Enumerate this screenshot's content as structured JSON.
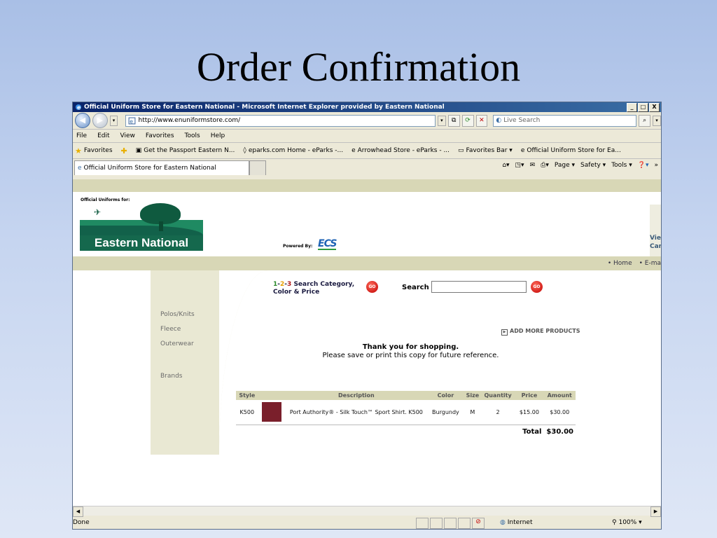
{
  "slide": {
    "title": "Order Confirmation"
  },
  "browser": {
    "title": "Official Uniform Store for Eastern National - Microsoft Internet Explorer provided by Eastern National",
    "window_buttons": [
      "_",
      "□",
      "X"
    ],
    "address": "http://www.enuniformstore.com/",
    "search_placeholder": "Live Search",
    "menu": [
      "File",
      "Edit",
      "View",
      "Favorites",
      "Tools",
      "Help"
    ],
    "favorites_label": "Favorites",
    "favorites_items": [
      "Get the Passport Eastern N...",
      "eparks.com Home - eParks -...",
      "Arrowhead Store - eParks - ...",
      "Favorites Bar ▾",
      "Official Uniform Store for Ea..."
    ],
    "tab_title": "Official Uniform Store for Eastern National",
    "command_bar": [
      "Page ▾",
      "Safety ▾",
      "Tools ▾"
    ],
    "status_text": "Done",
    "zone": "Internet",
    "zoom": "100%"
  },
  "site": {
    "header_small": "Official Uniforms for:",
    "logo_text": "Eastern National",
    "powered_by": "Powered By:",
    "ecs_logo": "ECS",
    "right_edge": [
      "Vie",
      "Car"
    ],
    "nav_links": [
      "• Home",
      "• E-ma"
    ],
    "sidebar": [
      "Polos/Knits",
      "Fleece",
      "Outerwear",
      "Brands"
    ],
    "steps_line1_prefix": "1-2-3",
    "steps_numbers": [
      "1",
      "2",
      "3"
    ],
    "steps_line1": "Search Category,",
    "steps_line2": "Color & Price",
    "go": "GO",
    "search_label": "Search",
    "add_more": "ADD MORE PRODUCTS",
    "thanks_line1": "Thank you for shopping.",
    "thanks_line2": "Please save or print this copy for future reference."
  },
  "order": {
    "headers": [
      "Style",
      "Description",
      "Color",
      "Size",
      "Quantity",
      "Price",
      "Amount"
    ],
    "rows": [
      {
        "style": "K500",
        "description": "Port Authority® - Silk Touch™ Sport Shirt. K500",
        "color": "Burgundy",
        "size": "M",
        "quantity": "2",
        "price": "$15.00",
        "amount": "$30.00",
        "swatch_color": "#7a1f2b"
      }
    ],
    "total_label": "Total",
    "total": "$30.00"
  }
}
